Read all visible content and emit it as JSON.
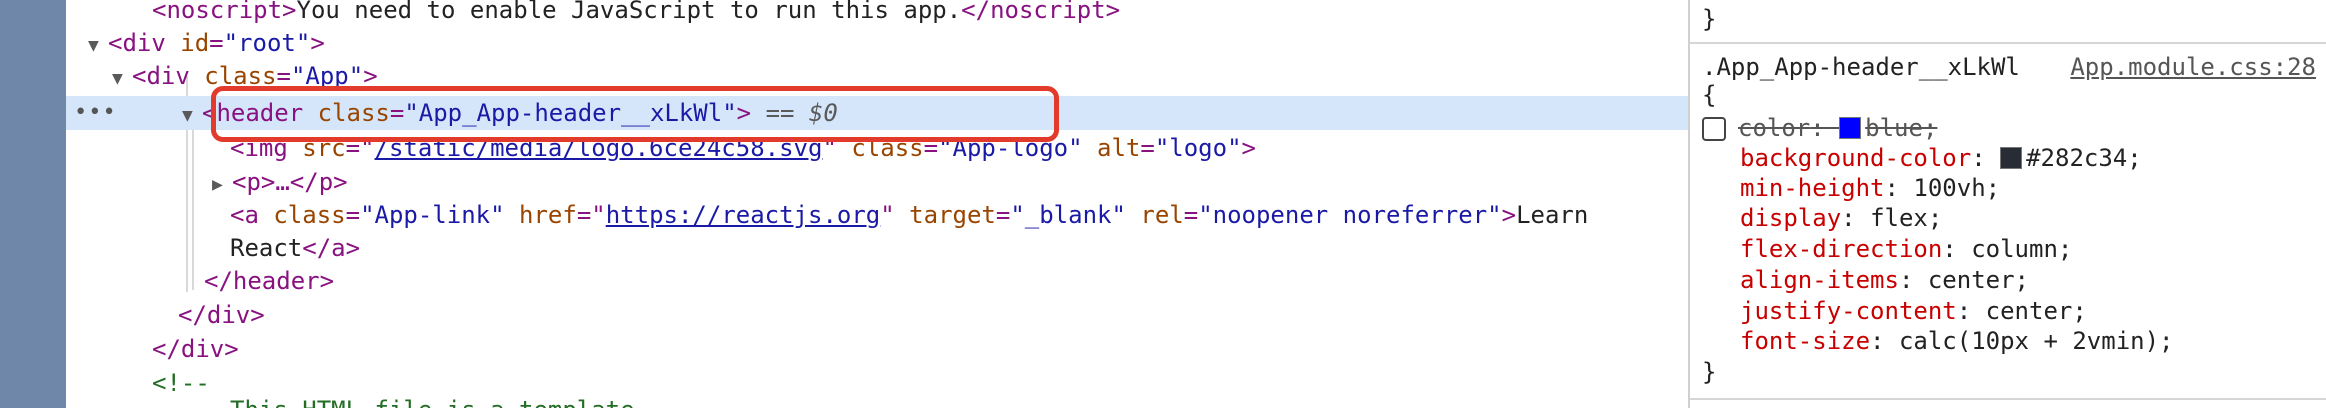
{
  "dom": {
    "noscript_open": "<noscript>",
    "noscript_text": "You need to enable JavaScript to run this app.",
    "noscript_close": "</noscript>",
    "div_root_tag": "<div",
    "div_root_attr": "id",
    "div_root_val": "\"root\"",
    "div_app_tag": "<div",
    "div_app_attr": "class",
    "div_app_val": "\"App\"",
    "header_tag": "<header",
    "header_attr": "class",
    "header_val": "\"App_App-header__xLkWl\"",
    "header_eq": "== $0",
    "img_tag": "<img",
    "img_src_attr": "src",
    "img_src_val": "/static/media/logo.6ce24c58.svg",
    "img_class_attr": "class",
    "img_class_val": "\"App-logo\"",
    "img_alt_attr": "alt",
    "img_alt_val": "\"logo\"",
    "p_tag": "<p>…</p>",
    "a_tag": "<a",
    "a_class_attr": "class",
    "a_class_val": "\"App-link\"",
    "a_href_attr": "href",
    "a_href_val": "https://reactjs.org",
    "a_target_attr": "target",
    "a_target_val": "\"_blank\"",
    "a_rel_attr": "rel",
    "a_rel_val": "\"noopener noreferrer\"",
    "a_text_1": "Learn",
    "a_text_2": "React",
    "a_close": "</a>",
    "header_close": "</header>",
    "div_close_1": "</div>",
    "div_close_2": "</div>",
    "comment_open": "<!--",
    "comment_partial": "This HTML file is a template."
  },
  "styles": {
    "prev_brace": "}",
    "selector": ".App_App-header__xLkWl",
    "source": "App.module.css:28",
    "open_brace": "{",
    "close_brace": "}",
    "disabled_prop": "color",
    "disabled_val": "blue;",
    "props": [
      {
        "name": "background-color",
        "value": "#282c34;"
      },
      {
        "name": "min-height",
        "value": "100vh;"
      },
      {
        "name": "display",
        "value": "flex;"
      },
      {
        "name": "flex-direction",
        "value": "column;"
      },
      {
        "name": "align-items",
        "value": "center;"
      },
      {
        "name": "justify-content",
        "value": "center;"
      },
      {
        "name": "font-size",
        "value": "calc(10px + 2vmin);"
      }
    ],
    "colors": {
      "blue_swatch": "#0000ff",
      "bg_swatch": "#282c34"
    }
  }
}
